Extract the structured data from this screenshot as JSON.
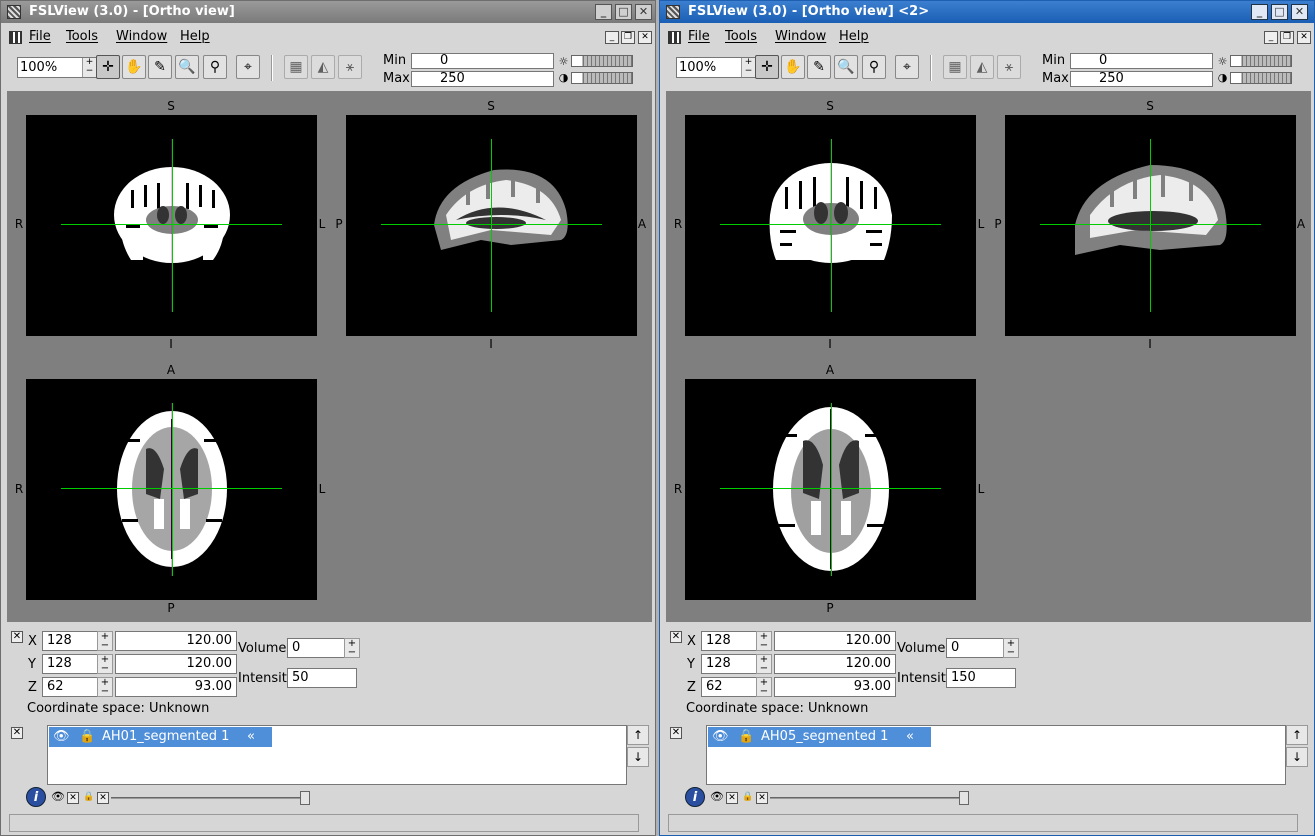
{
  "windows": [
    {
      "title": "FSLView (3.0) - [Ortho view]",
      "menu": [
        "File",
        "Tools",
        "Window",
        "Help"
      ],
      "zoom": "100%",
      "min_label": "Min",
      "min_value": "0",
      "max_label": "Max",
      "max_value": "250",
      "orientation": {
        "coronal": [
          "S",
          "R",
          "L",
          "I"
        ],
        "sagittal": [
          "S",
          "P",
          "A",
          "I"
        ],
        "axial": [
          "A",
          "R",
          "L",
          "P"
        ]
      },
      "coords": {
        "x_label": "X",
        "x_vox": "128",
        "x_mm": "120.00",
        "y_label": "Y",
        "y_vox": "128",
        "y_mm": "120.00",
        "z_label": "Z",
        "z_vox": "62",
        "z_mm": "93.00",
        "volume_label": "Volume",
        "volume": "0",
        "intensity_label": "Intensity",
        "intensity": "50",
        "space": "Coordinate space: Unknown"
      },
      "layer": "AH01_segmented 1"
    },
    {
      "title": "FSLView (3.0) - [Ortho view] <2>",
      "menu": [
        "File",
        "Tools",
        "Window",
        "Help"
      ],
      "zoom": "100%",
      "min_label": "Min",
      "min_value": "0",
      "max_label": "Max",
      "max_value": "250",
      "orientation": {
        "coronal": [
          "S",
          "R",
          "L",
          "I"
        ],
        "sagittal": [
          "S",
          "P",
          "A",
          "I"
        ],
        "axial": [
          "A",
          "R",
          "L",
          "P"
        ]
      },
      "coords": {
        "x_label": "X",
        "x_vox": "128",
        "x_mm": "120.00",
        "y_label": "Y",
        "y_vox": "128",
        "y_mm": "120.00",
        "z_label": "Z",
        "z_vox": "62",
        "z_mm": "93.00",
        "volume_label": "Volume",
        "volume": "0",
        "intensity_label": "Intensity",
        "intensity": "150",
        "space": "Coordinate space: Unknown"
      },
      "layer": "AH05_segmented 1"
    }
  ],
  "colors": {
    "crosshair": "#00cc00",
    "selection": "#4f8ed8",
    "active_title": "#1a5fb4",
    "inactive_title": "#7a7a7a"
  }
}
